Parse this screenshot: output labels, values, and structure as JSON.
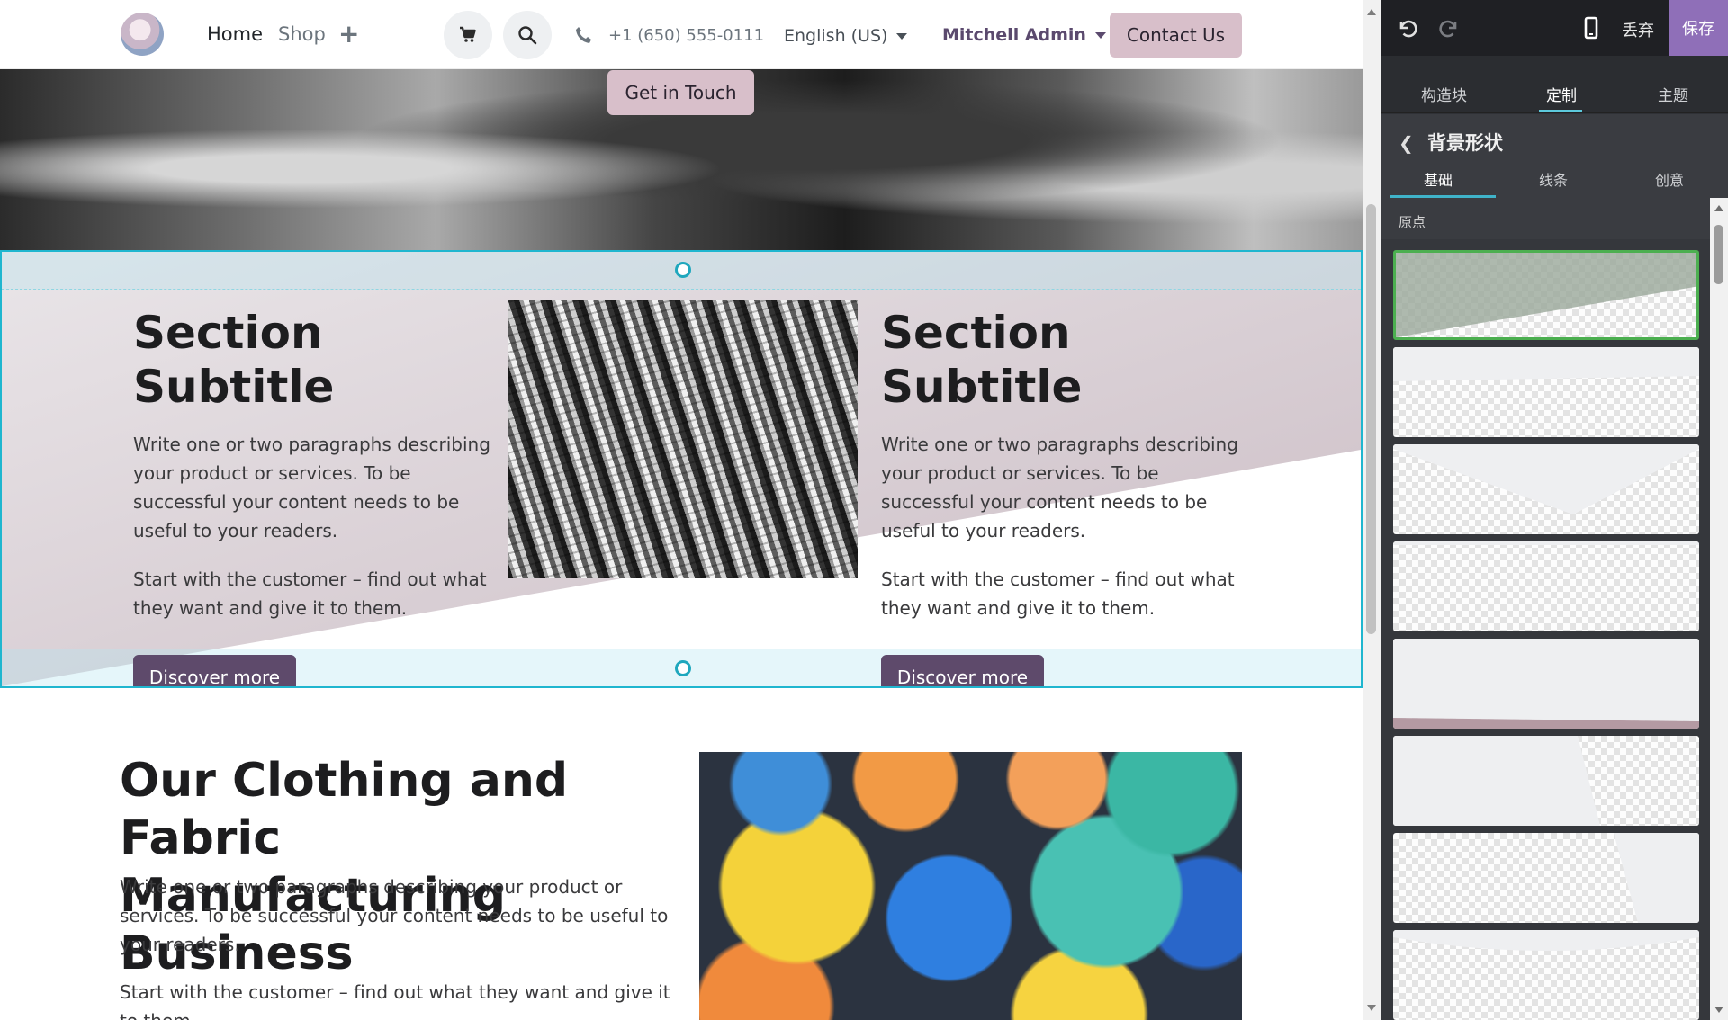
{
  "header": {
    "nav": {
      "home": "Home",
      "shop": "Shop",
      "add": "+"
    },
    "phone": "+1 (650) 555-0111",
    "language": "English (US)",
    "user": "Mitchell Admin",
    "contact_label": "Contact Us"
  },
  "hero": {
    "button_label": "Get in Touch"
  },
  "section": {
    "col1": {
      "title": "Section Subtitle",
      "p1": "Write one or two paragraphs describing your product or services. To be successful your content needs to be useful to your readers.",
      "p2": "Start with the customer – find out what they want and give it to them.",
      "button": "Discover more"
    },
    "col2": {
      "title": "Section Subtitle",
      "p1": "Write one or two paragraphs describing your product or services. To be successful your content needs to be useful to your readers.",
      "p2": "Start with the customer – find out what they want and give it to them.",
      "button": "Discover more"
    }
  },
  "lower": {
    "title": "Our Clothing and Fabric Manufacturing Business",
    "p1": "Write one or two paragraphs describing your product or services. To be successful your content needs to be useful to your readers.",
    "p2": "Start with the customer – find out what they want and give it to them."
  },
  "panel": {
    "discard": "丢弃",
    "save": "保存",
    "tabs": [
      "构造块",
      "定制",
      "主题"
    ],
    "active_tab": "定制",
    "option_title": "背景形状",
    "subtabs": [
      "基础",
      "线条",
      "创意"
    ],
    "active_subtab": "基础",
    "group_label": "原点"
  },
  "colors": {
    "accent": "#8f6fb8",
    "selection": "#1fb6cf",
    "button_primary": "#5e4a6b",
    "button_secondary": "#d8bfca"
  }
}
